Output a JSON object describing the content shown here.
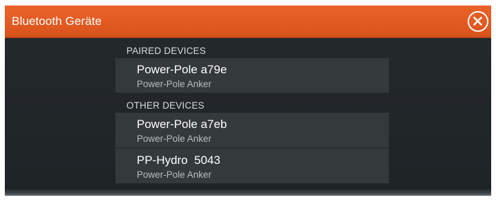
{
  "dialog": {
    "title": "Bluetooth Geräte",
    "close_icon": "close-circle-icon"
  },
  "sections": {
    "paired": {
      "header": "PAIRED DEVICES",
      "devices": [
        {
          "name": "Power-Pole a79e",
          "subtitle": "Power-Pole Anker"
        }
      ]
    },
    "other": {
      "header": "OTHER DEVICES",
      "devices": [
        {
          "name": "Power-Pole a7eb",
          "subtitle": "Power-Pole Anker"
        },
        {
          "name": "PP-Hydro  5043",
          "subtitle": "Power-Pole Anker"
        }
      ]
    }
  },
  "colors": {
    "title_bar": "#e15a22",
    "background": "#222729",
    "row_background": "#34393c",
    "text_primary": "#ffffff",
    "text_secondary": "#b9bcbe"
  }
}
